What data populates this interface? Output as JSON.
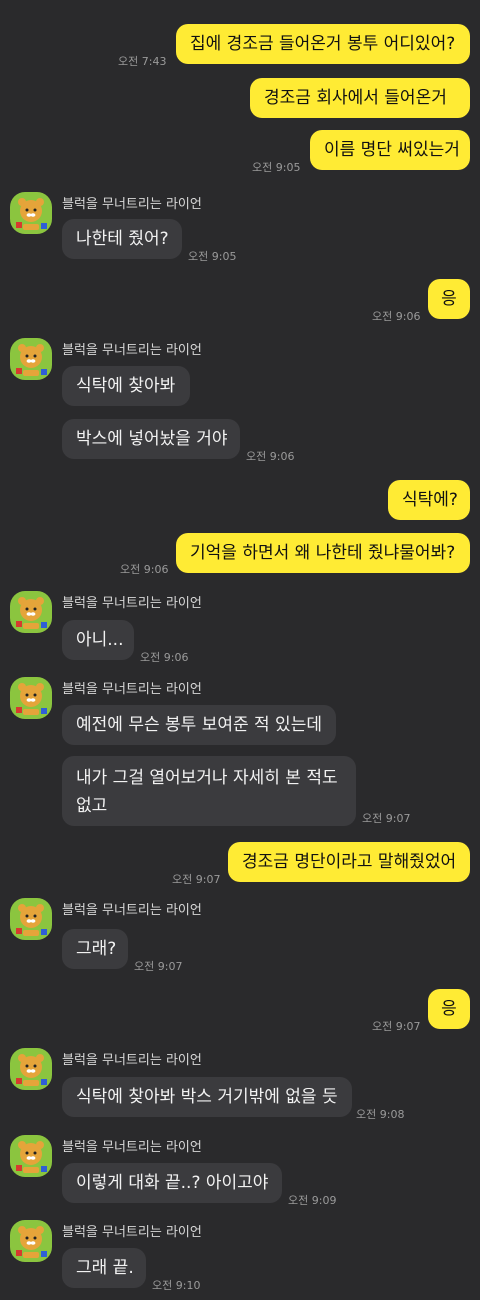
{
  "sender_name": "블럭을 무너트리는 라이언",
  "messages": [
    {
      "from": "me",
      "text": "집에 경조금 들어온거 봉투 어디있어?",
      "time": "오전 7:43"
    },
    {
      "from": "me",
      "text": "경조금 회사에서 들어온거",
      "time": ""
    },
    {
      "from": "me",
      "text": "이름 명단 써있는거",
      "time": "오전 9:05"
    },
    {
      "from": "them",
      "text": "나한테 줬어?",
      "time": "오전 9:05"
    },
    {
      "from": "me",
      "text": "응",
      "time": "오전 9:06"
    },
    {
      "from": "them",
      "text": "식탁에 찾아봐",
      "time": ""
    },
    {
      "from": "them",
      "text": "박스에 넣어놨을 거야",
      "time": "오전 9:06"
    },
    {
      "from": "me",
      "text": "식탁에?",
      "time": ""
    },
    {
      "from": "me",
      "text": "기억을 하면서 왜 나한테 줬냐물어봐?",
      "time": "오전 9:06"
    },
    {
      "from": "them",
      "text": "아니...",
      "time": "오전 9:06"
    },
    {
      "from": "them",
      "text": "예전에 무슨 봉투 보여준 적 있는데",
      "time": ""
    },
    {
      "from": "them",
      "text": "내가 그걸 열어보거나 자세히 본 적도 없고",
      "time": "오전 9:07"
    },
    {
      "from": "me",
      "text": "경조금 명단이라고 말해줬었어",
      "time": "오전 9:07"
    },
    {
      "from": "them",
      "text": "그래?",
      "time": "오전 9:07"
    },
    {
      "from": "me",
      "text": "응",
      "time": "오전 9:07"
    },
    {
      "from": "them",
      "text": "식탁에 찾아봐 박스 거기밖에 없을 듯",
      "time": "오전 9:08"
    },
    {
      "from": "them",
      "text": "이렇게 대화 끝..? 아이고야",
      "time": "오전 9:09"
    },
    {
      "from": "them",
      "text": "그래 끝.",
      "time": "오전 9:10"
    }
  ],
  "colors": {
    "background": "#2a2a2c",
    "my_bubble": "#ffeb34",
    "their_bubble": "#3b3b3e",
    "avatar_bg": "#8bc53f"
  },
  "icons": {
    "avatar": "ryan-character-avatar-icon"
  }
}
